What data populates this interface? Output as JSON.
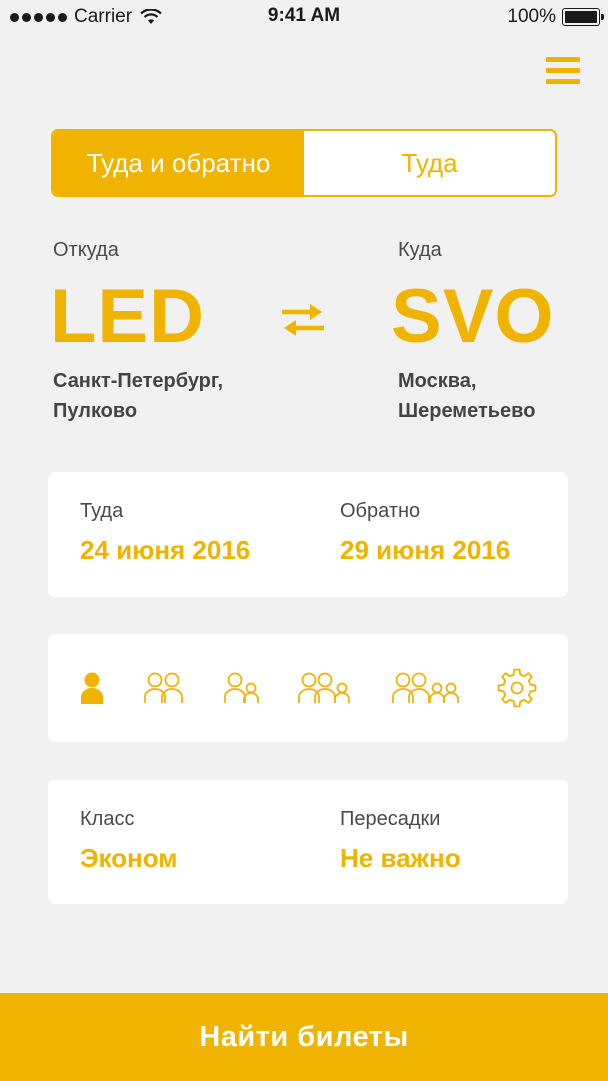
{
  "status_bar": {
    "carrier": "Carrier",
    "time": "9:41 AM",
    "battery": "100%"
  },
  "trip_type": {
    "round_trip": "Туда и обратно",
    "one_way": "Туда",
    "selected": "round_trip"
  },
  "route": {
    "from_label": "Откуда",
    "from_code": "LED",
    "from_city": "Санкт-Петербург, Пулково",
    "to_label": "Куда",
    "to_code": "SVO",
    "to_city": "Москва, Шереметьево"
  },
  "dates": {
    "depart_label": "Туда",
    "depart_value": "24 июня 2016",
    "return_label": "Обратно",
    "return_value": "29 июня 2016"
  },
  "passengers": {
    "options": [
      "one-adult-icon",
      "two-adults-icon",
      "adult-child-icon",
      "two-adults-child-icon",
      "two-adults-two-children-icon",
      "settings-gear-icon"
    ],
    "selected_index": 0
  },
  "options": {
    "class_label": "Класс",
    "class_value": "Эконом",
    "transfers_label": "Пересадки",
    "transfers_value": "Не важно"
  },
  "search_button": "Найти билеты",
  "colors": {
    "accent": "#f0b400",
    "background": "#f1f1f1",
    "text": "#4a4a4a"
  }
}
